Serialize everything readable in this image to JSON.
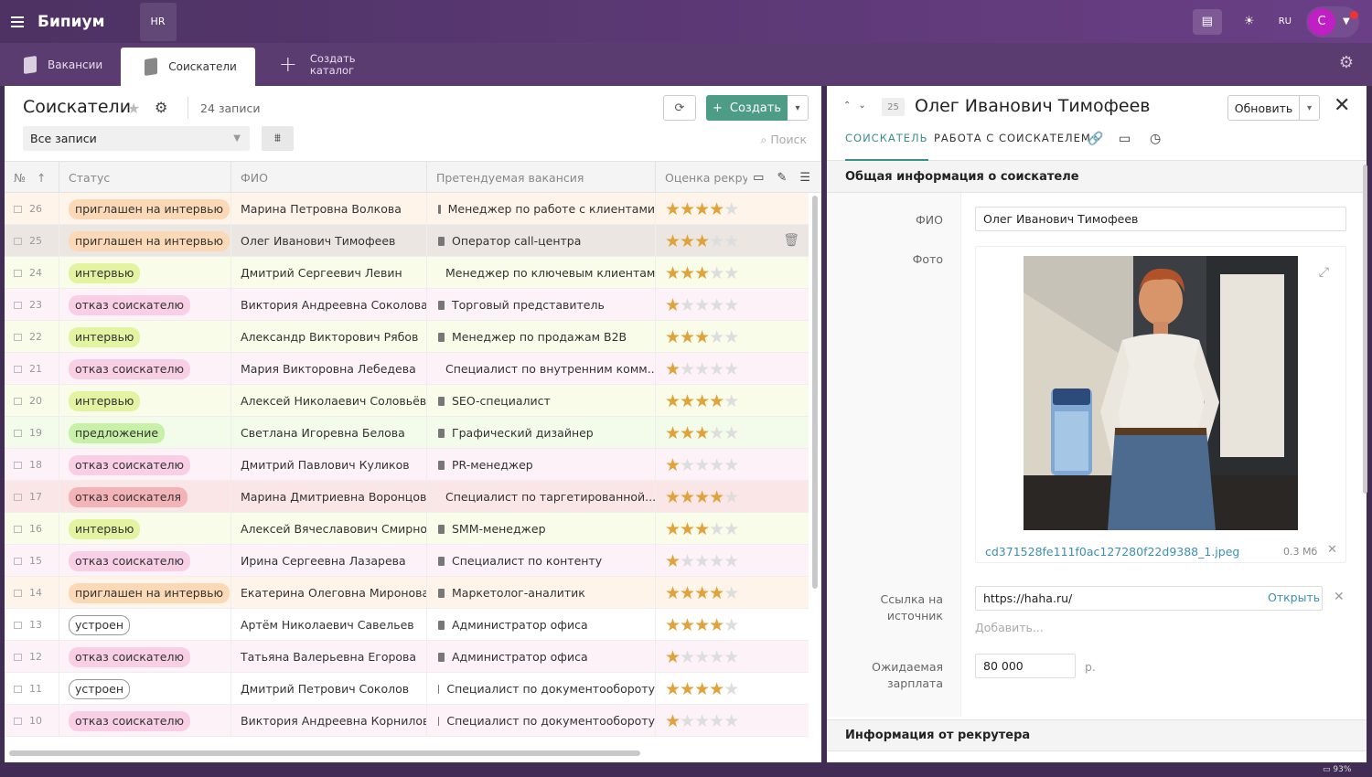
{
  "app": {
    "logo": "Бипиум",
    "workspace": "HR",
    "lang": "RU",
    "avatar_letter": "С"
  },
  "tabs": [
    {
      "label": "Вакансии"
    },
    {
      "label": "Соискатели"
    },
    {
      "label": "Создать\nкаталог"
    }
  ],
  "list": {
    "title": "Соискатели",
    "count": "24 записи",
    "create_label": "Создать",
    "filter_value": "Все записи",
    "search_placeholder": "Поиск",
    "columns": [
      "№",
      "Статус",
      "ФИО",
      "Претендуемая вакансия",
      "Оценка рекру"
    ],
    "rows": [
      {
        "num": "26",
        "status": "приглашен на интервью",
        "fio": "Марина Петровна Волкова",
        "vacancy": "Менеджер по работе с клиентами",
        "rating": 4
      },
      {
        "num": "25",
        "status": "приглашен на интервью",
        "fio": "Олег Иванович Тимофеев",
        "vacancy": "Оператор call-центра",
        "rating": 3
      },
      {
        "num": "24",
        "status": "интервью",
        "fio": "Дмитрий Сергеевич Левин",
        "vacancy": "Менеджер по ключевым клиентам",
        "rating": 3
      },
      {
        "num": "23",
        "status": "отказ соискателю",
        "fio": "Виктория Андреевна Соколова",
        "vacancy": "Торговый представитель",
        "rating": 1
      },
      {
        "num": "22",
        "status": "интервью",
        "fio": "Александр Викторович Рябов",
        "vacancy": "Менеджер по продажам B2B",
        "rating": 3
      },
      {
        "num": "21",
        "status": "отказ соискателю",
        "fio": "Мария Викторовна Лебедева",
        "vacancy": "Специалист по внутренним комм...",
        "rating": 1
      },
      {
        "num": "20",
        "status": "интервью",
        "fio": "Алексей Николаевич Соловьёв",
        "vacancy": "SEO-специалист",
        "rating": 4
      },
      {
        "num": "19",
        "status": "предложение",
        "fio": "Светлана Игоревна Белова",
        "vacancy": "Графический дизайнер",
        "rating": 3
      },
      {
        "num": "18",
        "status": "отказ соискателю",
        "fio": "Дмитрий Павлович Куликов",
        "vacancy": "PR-менеджер",
        "rating": 1
      },
      {
        "num": "17",
        "status": "отказ соискателя",
        "fio": "Марина Дмитриевна Воронцова",
        "vacancy": "Специалист по таргетированной...",
        "rating": 4
      },
      {
        "num": "16",
        "status": "интервью",
        "fio": "Алексей Вячеславович Смирнов",
        "vacancy": "SMM-менеджер",
        "rating": 3
      },
      {
        "num": "15",
        "status": "отказ соискателю",
        "fio": "Ирина Сергеевна Лазарева",
        "vacancy": "Специалист по контенту",
        "rating": 1
      },
      {
        "num": "14",
        "status": "приглашен на интервью",
        "fio": "Екатерина Олеговна Миронова",
        "vacancy": "Маркетолог-аналитик",
        "rating": 4
      },
      {
        "num": "13",
        "status": "устроен",
        "fio": "Артём Николаевич Савельев",
        "vacancy": "Администратор офиса",
        "rating": 4
      },
      {
        "num": "12",
        "status": "отказ соискателю",
        "fio": "Татьяна Валерьевна Егорова",
        "vacancy": "Администратор офиса",
        "rating": 1
      },
      {
        "num": "11",
        "status": "устроен",
        "fio": "Дмитрий Петрович Соколов",
        "vacancy": "Специалист по документообороту",
        "rating": 4
      },
      {
        "num": "10",
        "status": "отказ соискателю",
        "fio": "Виктория Андреевна Корнилова",
        "vacancy": "Специалист по документообороту",
        "rating": 1
      }
    ]
  },
  "status_colors": {
    "приглашен на интервью": {
      "bg": "#fbd9b6",
      "row": "#fff4ea"
    },
    "интервью": {
      "bg": "#e2f3a2",
      "row": "#f8fce9"
    },
    "отказ соискателю": {
      "bg": "#f8cfe4",
      "row": "#fdf2f8"
    },
    "предложение": {
      "bg": "#c8f0a8",
      "row": "#f3fbea"
    },
    "отказ соискателя": {
      "bg": "#f3b3b7",
      "row": "#fbe6e7"
    },
    "устроен": {
      "bg": "#ffffff",
      "row": "#ffffff"
    }
  },
  "record": {
    "number": "25",
    "title": "Олег Иванович Тимофеев",
    "update_label": "Обновить",
    "tabs": [
      "СОИСКАТЕЛЬ",
      "РАБОТА С СОИСКАТЕЛЕМ"
    ],
    "section_general": "Общая информация о соискателе",
    "label_fio": "ФИО",
    "fio_value": "Олег Иванович Тимофеев",
    "label_photo": "Фото",
    "photo_file": "cd371528fe111f0ac127280f22d9388_1.jpeg",
    "photo_size": "0.3 Мб",
    "label_source": "Ссылка на источник",
    "source_value": "https://haha.ru/",
    "open_label": "Открыть",
    "add_label": "Добавить...",
    "label_salary": "Ожидаемая зарплата",
    "salary_value": "80 000",
    "salary_unit": "р.",
    "section_recruiter": "Информация от рекрутера"
  },
  "status_bar": {
    "zoom": "93%"
  }
}
